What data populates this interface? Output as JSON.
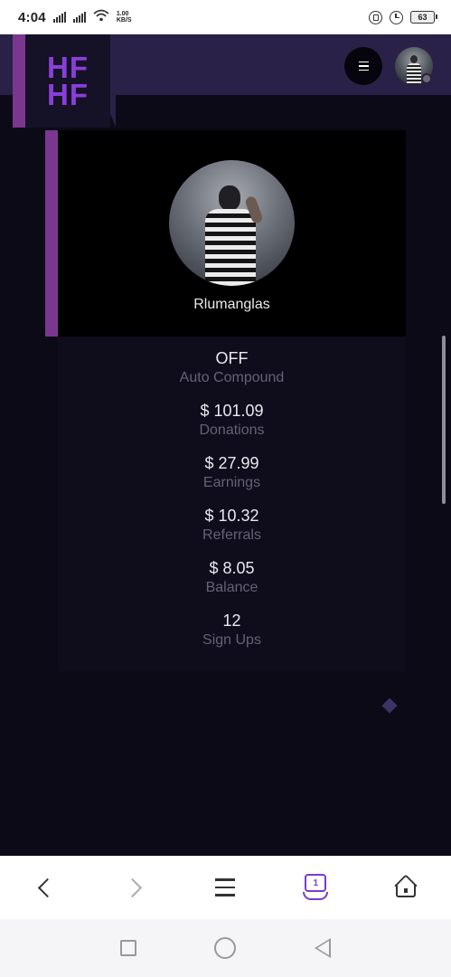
{
  "status_bar": {
    "time": "4:04",
    "net_speed_value": "1.00",
    "net_speed_unit": "KB/S",
    "battery": "63"
  },
  "header": {
    "logo_line1": "HF",
    "logo_line2": "HF",
    "menu_icon": "hamburger-icon",
    "avatar": "user-avatar"
  },
  "profile": {
    "name": "Rlumanglas"
  },
  "stats": [
    {
      "value": "OFF",
      "label": "Auto Compound"
    },
    {
      "value": "$ 101.09",
      "label": "Donations"
    },
    {
      "value": "$ 27.99",
      "label": "Earnings"
    },
    {
      "value": "$ 10.32",
      "label": "Referrals"
    },
    {
      "value": "$ 8.05",
      "label": "Balance"
    },
    {
      "value": "12",
      "label": "Sign Ups"
    }
  ],
  "browser_toolbar": {
    "tab_count": "1",
    "icons": [
      "back-icon",
      "forward-icon",
      "menu-icon",
      "tabs-icon",
      "home-icon"
    ]
  },
  "colors": {
    "accent_purple": "#7b3790",
    "logo_purple": "#8a3fd8",
    "header_bg": "#2a2148",
    "page_bg": "#0d0a18"
  }
}
